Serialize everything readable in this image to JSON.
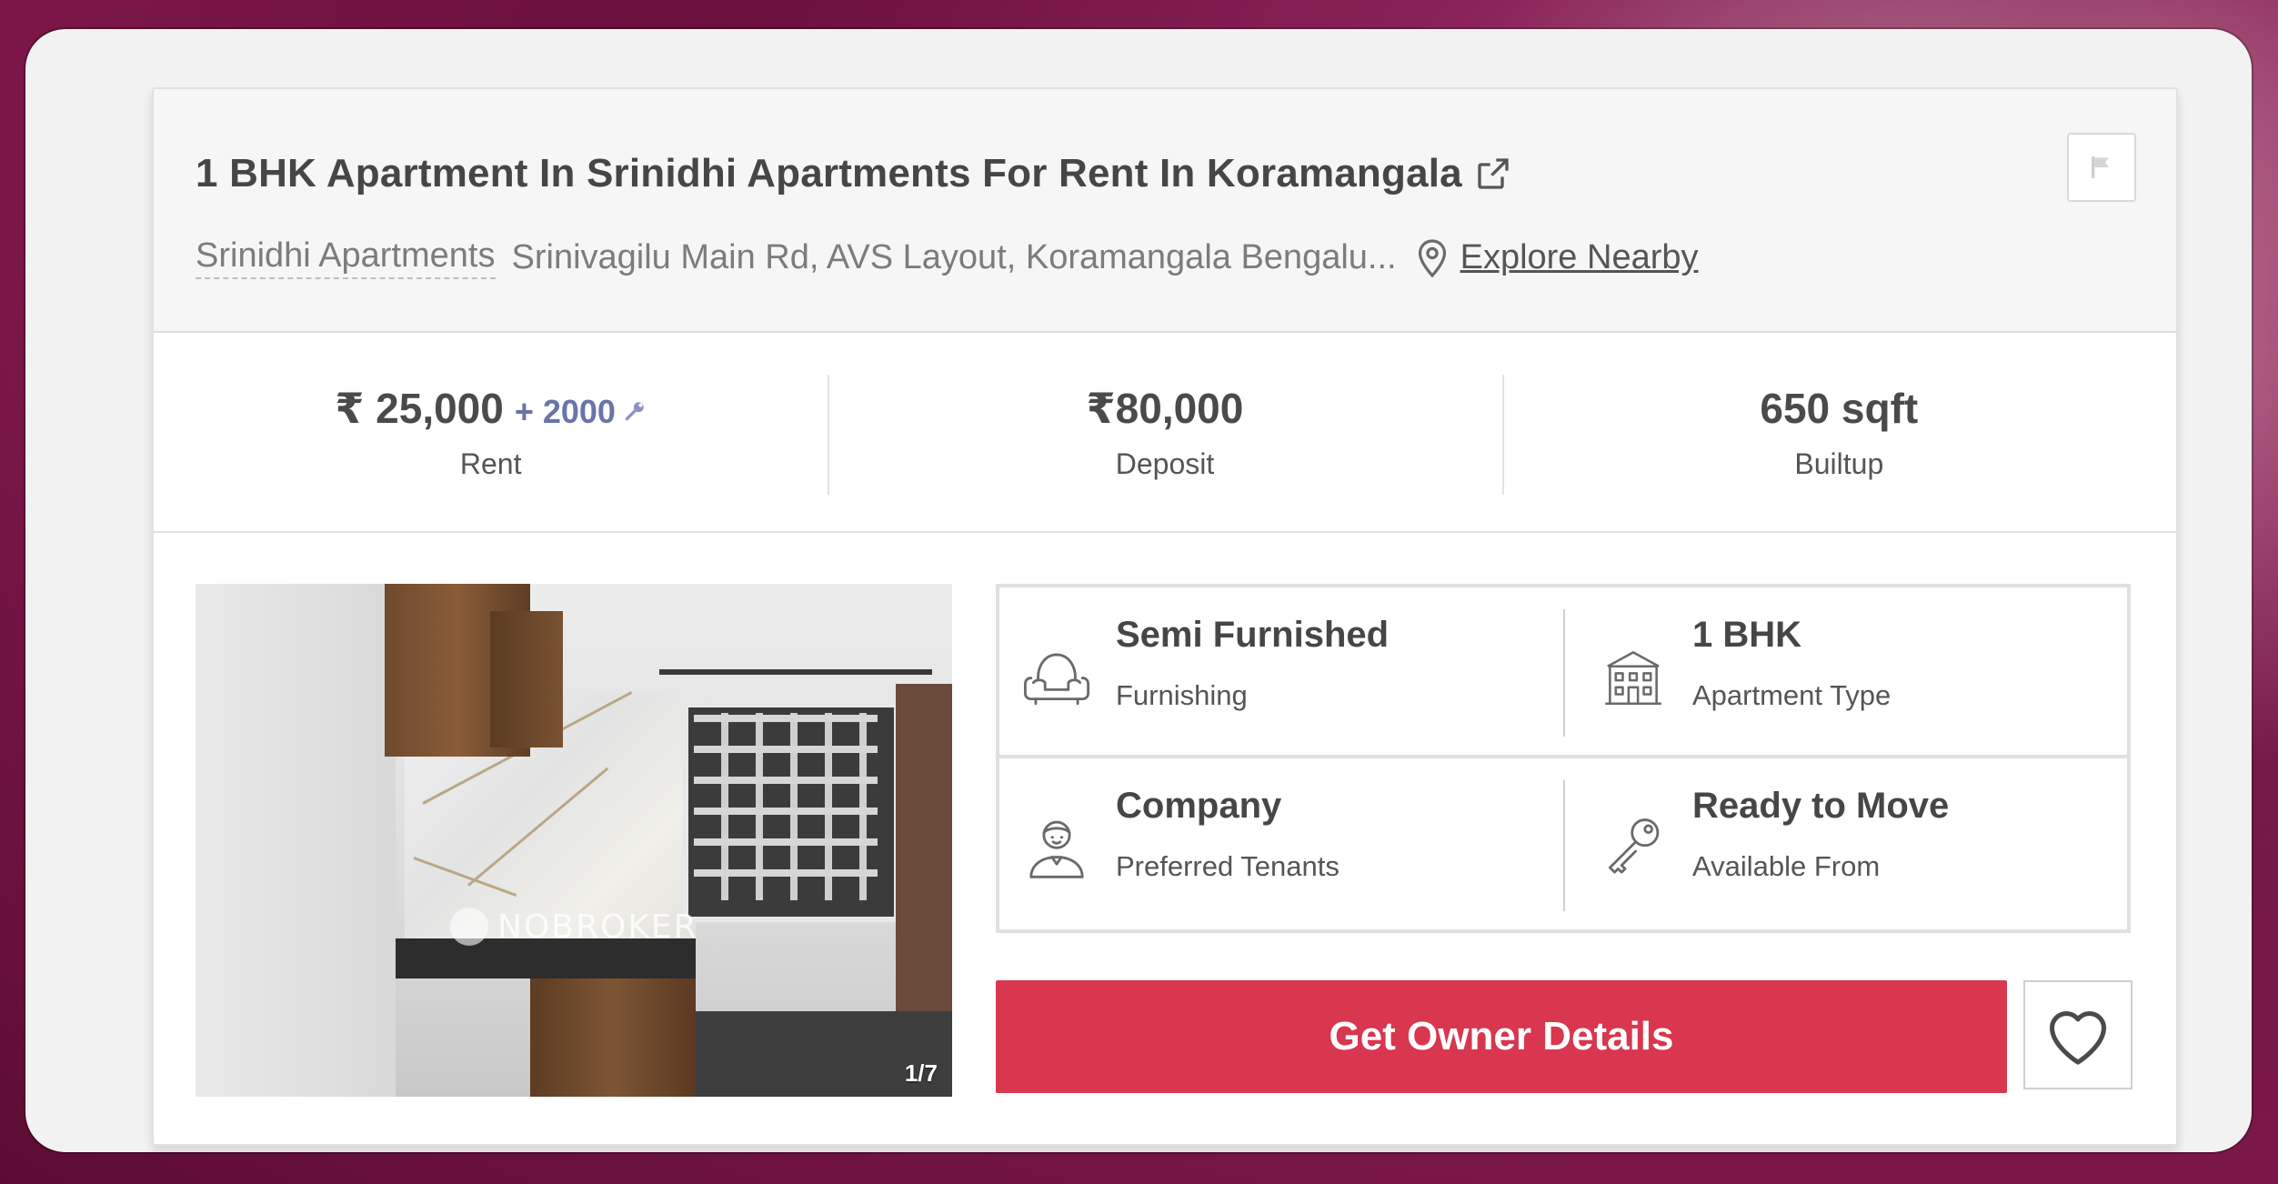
{
  "listing": {
    "title": "1 BHK Apartment In Srinidhi Apartments For Rent In Koramangala",
    "society": "Srinidhi Apartments",
    "address": "Srinivagilu Main Rd, AVS Layout, Koramangala Bengalu...",
    "explore_label": "Explore Nearby"
  },
  "stats": {
    "rent": {
      "value": "₹ 25,000",
      "extra": "+ 2000",
      "label": "Rent"
    },
    "deposit": {
      "value": "₹80,000",
      "label": "Deposit"
    },
    "builtup": {
      "value": "650 sqft",
      "label": "Builtup"
    }
  },
  "photo": {
    "watermark": "NOBROKER",
    "counter": "1/7"
  },
  "details": {
    "furnishing": {
      "value": "Semi Furnished",
      "label": "Furnishing",
      "icon": "sofa-icon"
    },
    "apartment_type": {
      "value": "1 BHK",
      "label": "Apartment Type",
      "icon": "building-icon"
    },
    "tenants": {
      "value": "Company",
      "label": "Preferred Tenants",
      "icon": "person-icon"
    },
    "availability": {
      "value": "Ready to Move",
      "label": "Available From",
      "icon": "key-icon"
    }
  },
  "actions": {
    "cta_label": "Get Owner Details"
  },
  "colors": {
    "cta": "#d9364f",
    "extra_charge": "#6a74a8"
  }
}
